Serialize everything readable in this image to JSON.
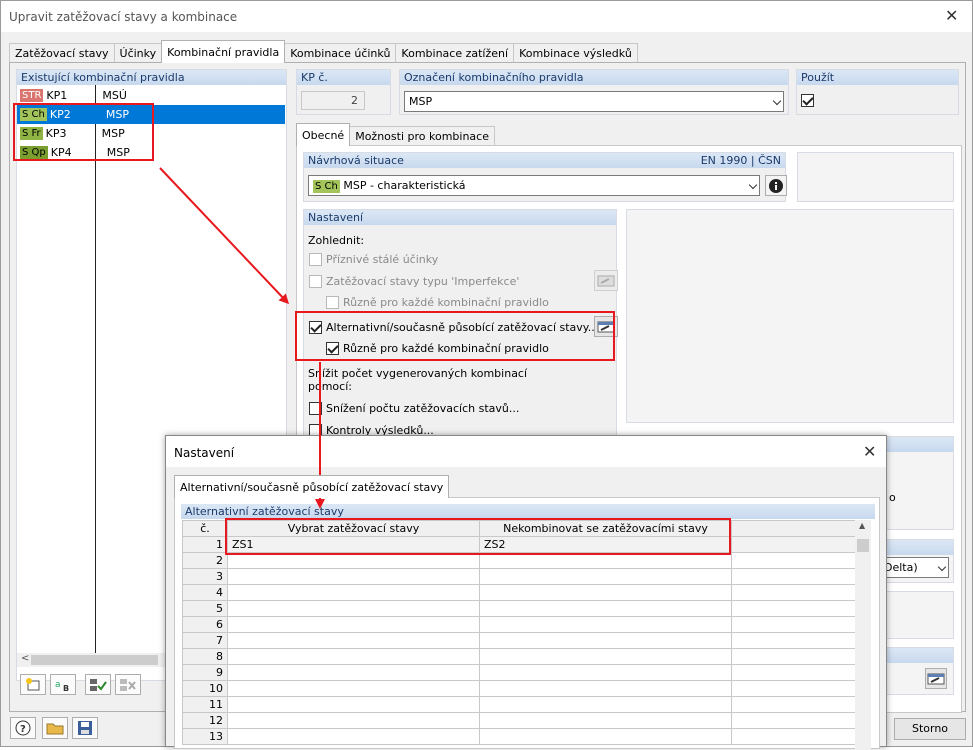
{
  "window": {
    "title": "Upravit zatěžovací stavy a kombinace"
  },
  "tabs": [
    "Zatěžovací stavy",
    "Účinky",
    "Kombinační pravidla",
    "Kombinace účinků",
    "Kombinace zatížení",
    "Kombinace výsledků"
  ],
  "rules_panel": {
    "header": "Existující kombinační pravidla",
    "rows": [
      {
        "badge": "STR",
        "id": "KP1",
        "name": "MSÚ"
      },
      {
        "badge": "S Ch",
        "id": "KP2",
        "name": "MSP"
      },
      {
        "badge": "S Fr",
        "id": "KP3",
        "name": "MSP"
      },
      {
        "badge": "S Qp",
        "id": "KP4",
        "name": "MSP"
      }
    ],
    "selected": 1
  },
  "kp": {
    "label": "KP č.",
    "value": "2"
  },
  "designation": {
    "label": "Označení kombinačního pravidla",
    "value": "MSP"
  },
  "use": {
    "label": "Použít"
  },
  "subtabs": [
    "Obecné",
    "Možnosti pro kombinace"
  ],
  "design_situation": {
    "label": "Návrhová situace",
    "standard": "EN 1990 | ČSN",
    "badge": "S Ch",
    "value": "MSP - charakteristická"
  },
  "settings": {
    "header": "Nastavení",
    "consider": "Zohlednit:",
    "opt1": "Příznivé stálé účinky",
    "opt2": "Zatěžovací stavy typu 'Imperfekce'",
    "opt3": "Různě pro každé kombinační pravidlo",
    "opt4": "Alternativní/současně působící zatěžovací stavy...",
    "opt5": "Různě pro každé kombinační pravidlo",
    "reduce_line1": "Snížit počet vygenerovaných kombinací",
    "reduce_line2": "pomocí:",
    "opt6": "Snížení počtu zatěžovacích stavů...",
    "opt7": "Kontroly výsledků..."
  },
  "partial": {
    "right_text1": "o",
    "right_combo": "-Delta)"
  },
  "bottom": {
    "storno": "Storno"
  },
  "dialog": {
    "title": "Nastavení",
    "tab": "Alternativní/současně působící zatěžovací stavy",
    "header": "Alternativní zatěžovací stavy",
    "columns": [
      "č.",
      "Vybrat zatěžovací stavy",
      "Nekombinovat se zatěžovacími stavy"
    ],
    "rows": [
      {
        "n": "1",
        "a": "ZS1",
        "b": "ZS2"
      },
      {
        "n": "2",
        "a": "",
        "b": ""
      },
      {
        "n": "3",
        "a": "",
        "b": ""
      },
      {
        "n": "4",
        "a": "",
        "b": ""
      },
      {
        "n": "5",
        "a": "",
        "b": ""
      },
      {
        "n": "6",
        "a": "",
        "b": ""
      },
      {
        "n": "7",
        "a": "",
        "b": ""
      },
      {
        "n": "8",
        "a": "",
        "b": ""
      },
      {
        "n": "9",
        "a": "",
        "b": ""
      },
      {
        "n": "10",
        "a": "",
        "b": ""
      },
      {
        "n": "11",
        "a": "",
        "b": ""
      },
      {
        "n": "12",
        "a": "",
        "b": ""
      },
      {
        "n": "13",
        "a": "",
        "b": ""
      }
    ]
  },
  "colors": {
    "annotation": "#e8191e",
    "selection": "#0078d7"
  }
}
